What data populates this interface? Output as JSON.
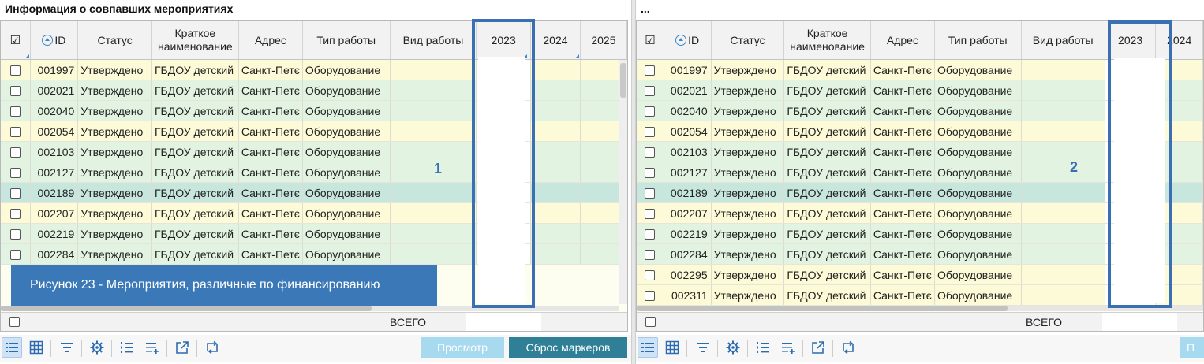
{
  "left_panel": {
    "title": "Информация о совпавших мероприятиях",
    "columns": [
      "☑",
      "ID",
      "Статус",
      "Краткое наименование",
      "Адрес",
      "Тип работы",
      "Вид работы",
      "2023",
      "2024",
      "2025"
    ],
    "rows": [
      {
        "id": "001997",
        "status": "Утверждено",
        "name": "ГБДОУ детский",
        "address": "Санкт-Петє",
        "type": "Оборудование",
        "state": "yellow"
      },
      {
        "id": "002021",
        "status": "Утверждено",
        "name": "ГБДОУ детский",
        "address": "Санкт-Петє",
        "type": "Оборудование",
        "state": "green"
      },
      {
        "id": "002040",
        "status": "Утверждено",
        "name": "ГБДОУ детский",
        "address": "Санкт-Петє",
        "type": "Оборудование",
        "state": "green"
      },
      {
        "id": "002054",
        "status": "Утверждено",
        "name": "ГБДОУ детский",
        "address": "Санкт-Петє",
        "type": "Оборудование",
        "state": "yellow"
      },
      {
        "id": "002103",
        "status": "Утверждено",
        "name": "ГБДОУ детский",
        "address": "Санкт-Петє",
        "type": "Оборудование",
        "state": "green"
      },
      {
        "id": "002127",
        "status": "Утверждено",
        "name": "ГБДОУ детский",
        "address": "Санкт-Петє",
        "type": "Оборудование",
        "state": "green"
      },
      {
        "id": "002189",
        "status": "Утверждено",
        "name": "ГБДОУ детский",
        "address": "Санкт-Петє",
        "type": "Оборудование",
        "state": "selected"
      },
      {
        "id": "002207",
        "status": "Утверждено",
        "name": "ГБДОУ детский",
        "address": "Санкт-Петє",
        "type": "Оборудование",
        "state": "yellow"
      },
      {
        "id": "002219",
        "status": "Утверждено",
        "name": "ГБДОУ детский",
        "address": "Санкт-Петє",
        "type": "Оборудование",
        "state": "green"
      },
      {
        "id": "002284",
        "status": "Утверждено",
        "name": "ГБДОУ детский",
        "address": "Санкт-Петє",
        "type": "Оборудование",
        "state": "green"
      }
    ],
    "total_label": "ВСЕГО",
    "marker_number": "1",
    "caption": "Рисунок 23 - Мероприятия, различные по финансированию",
    "view_button": "Просмотр",
    "reset_button": "Сброс маркеров"
  },
  "right_panel": {
    "title": "...",
    "columns": [
      "☑",
      "ID",
      "Статус",
      "Краткое наименование",
      "Адрес",
      "Тип работы",
      "Вид работы",
      "2023",
      "2024"
    ],
    "rows": [
      {
        "id": "001997",
        "status": "Утверждено",
        "name": "ГБДОУ детский",
        "address": "Санкт-Петє",
        "type": "Оборудование",
        "state": "yellow"
      },
      {
        "id": "002021",
        "status": "Утверждено",
        "name": "ГБДОУ детский",
        "address": "Санкт-Петє",
        "type": "Оборудование",
        "state": "green"
      },
      {
        "id": "002040",
        "status": "Утверждено",
        "name": "ГБДОУ детский",
        "address": "Санкт-Петє",
        "type": "Оборудование",
        "state": "green"
      },
      {
        "id": "002054",
        "status": "Утверждено",
        "name": "ГБДОУ детский",
        "address": "Санкт-Петє",
        "type": "Оборудование",
        "state": "yellow"
      },
      {
        "id": "002103",
        "status": "Утверждено",
        "name": "ГБДОУ детский",
        "address": "Санкт-Петє",
        "type": "Оборудование",
        "state": "green"
      },
      {
        "id": "002127",
        "status": "Утверждено",
        "name": "ГБДОУ детский",
        "address": "Санкт-Петє",
        "type": "Оборудование",
        "state": "green"
      },
      {
        "id": "002189",
        "status": "Утверждено",
        "name": "ГБДОУ детский",
        "address": "Санкт-Петє",
        "type": "Оборудование",
        "state": "selected"
      },
      {
        "id": "002207",
        "status": "Утверждено",
        "name": "ГБДОУ детский",
        "address": "Санкт-Петє",
        "type": "Оборудование",
        "state": "yellow"
      },
      {
        "id": "002219",
        "status": "Утверждено",
        "name": "ГБДОУ детский",
        "address": "Санкт-Петє",
        "type": "Оборудование",
        "state": "green"
      },
      {
        "id": "002284",
        "status": "Утверждено",
        "name": "ГБДОУ детский",
        "address": "Санкт-Петє",
        "type": "Оборудование",
        "state": "green"
      },
      {
        "id": "002295",
        "status": "Утверждено",
        "name": "ГБДОУ детский",
        "address": "Санкт-Петє",
        "type": "Оборудование",
        "state": "yellow"
      },
      {
        "id": "002311",
        "status": "Утверждено",
        "name": "ГБДОУ детский",
        "address": "Санкт-Петє",
        "type": "Оборудование",
        "state": "yellow"
      }
    ],
    "total_label": "ВСЕГО",
    "marker_number": "2",
    "view_button": "П"
  },
  "toolbar_icons": [
    "list-view-icon",
    "grid-view-icon",
    "filter-icon",
    "settings-icon",
    "numbered-list-icon",
    "add-rows-icon",
    "export-icon",
    "swap-icon"
  ],
  "colors": {
    "accent": "#3a70b2",
    "row_yellow": "#fdfbd7",
    "row_green": "#e3f3e1",
    "row_selected": "#c7e6de",
    "view_button": "#a7d9ef",
    "reset_button": "#2f7f96"
  }
}
